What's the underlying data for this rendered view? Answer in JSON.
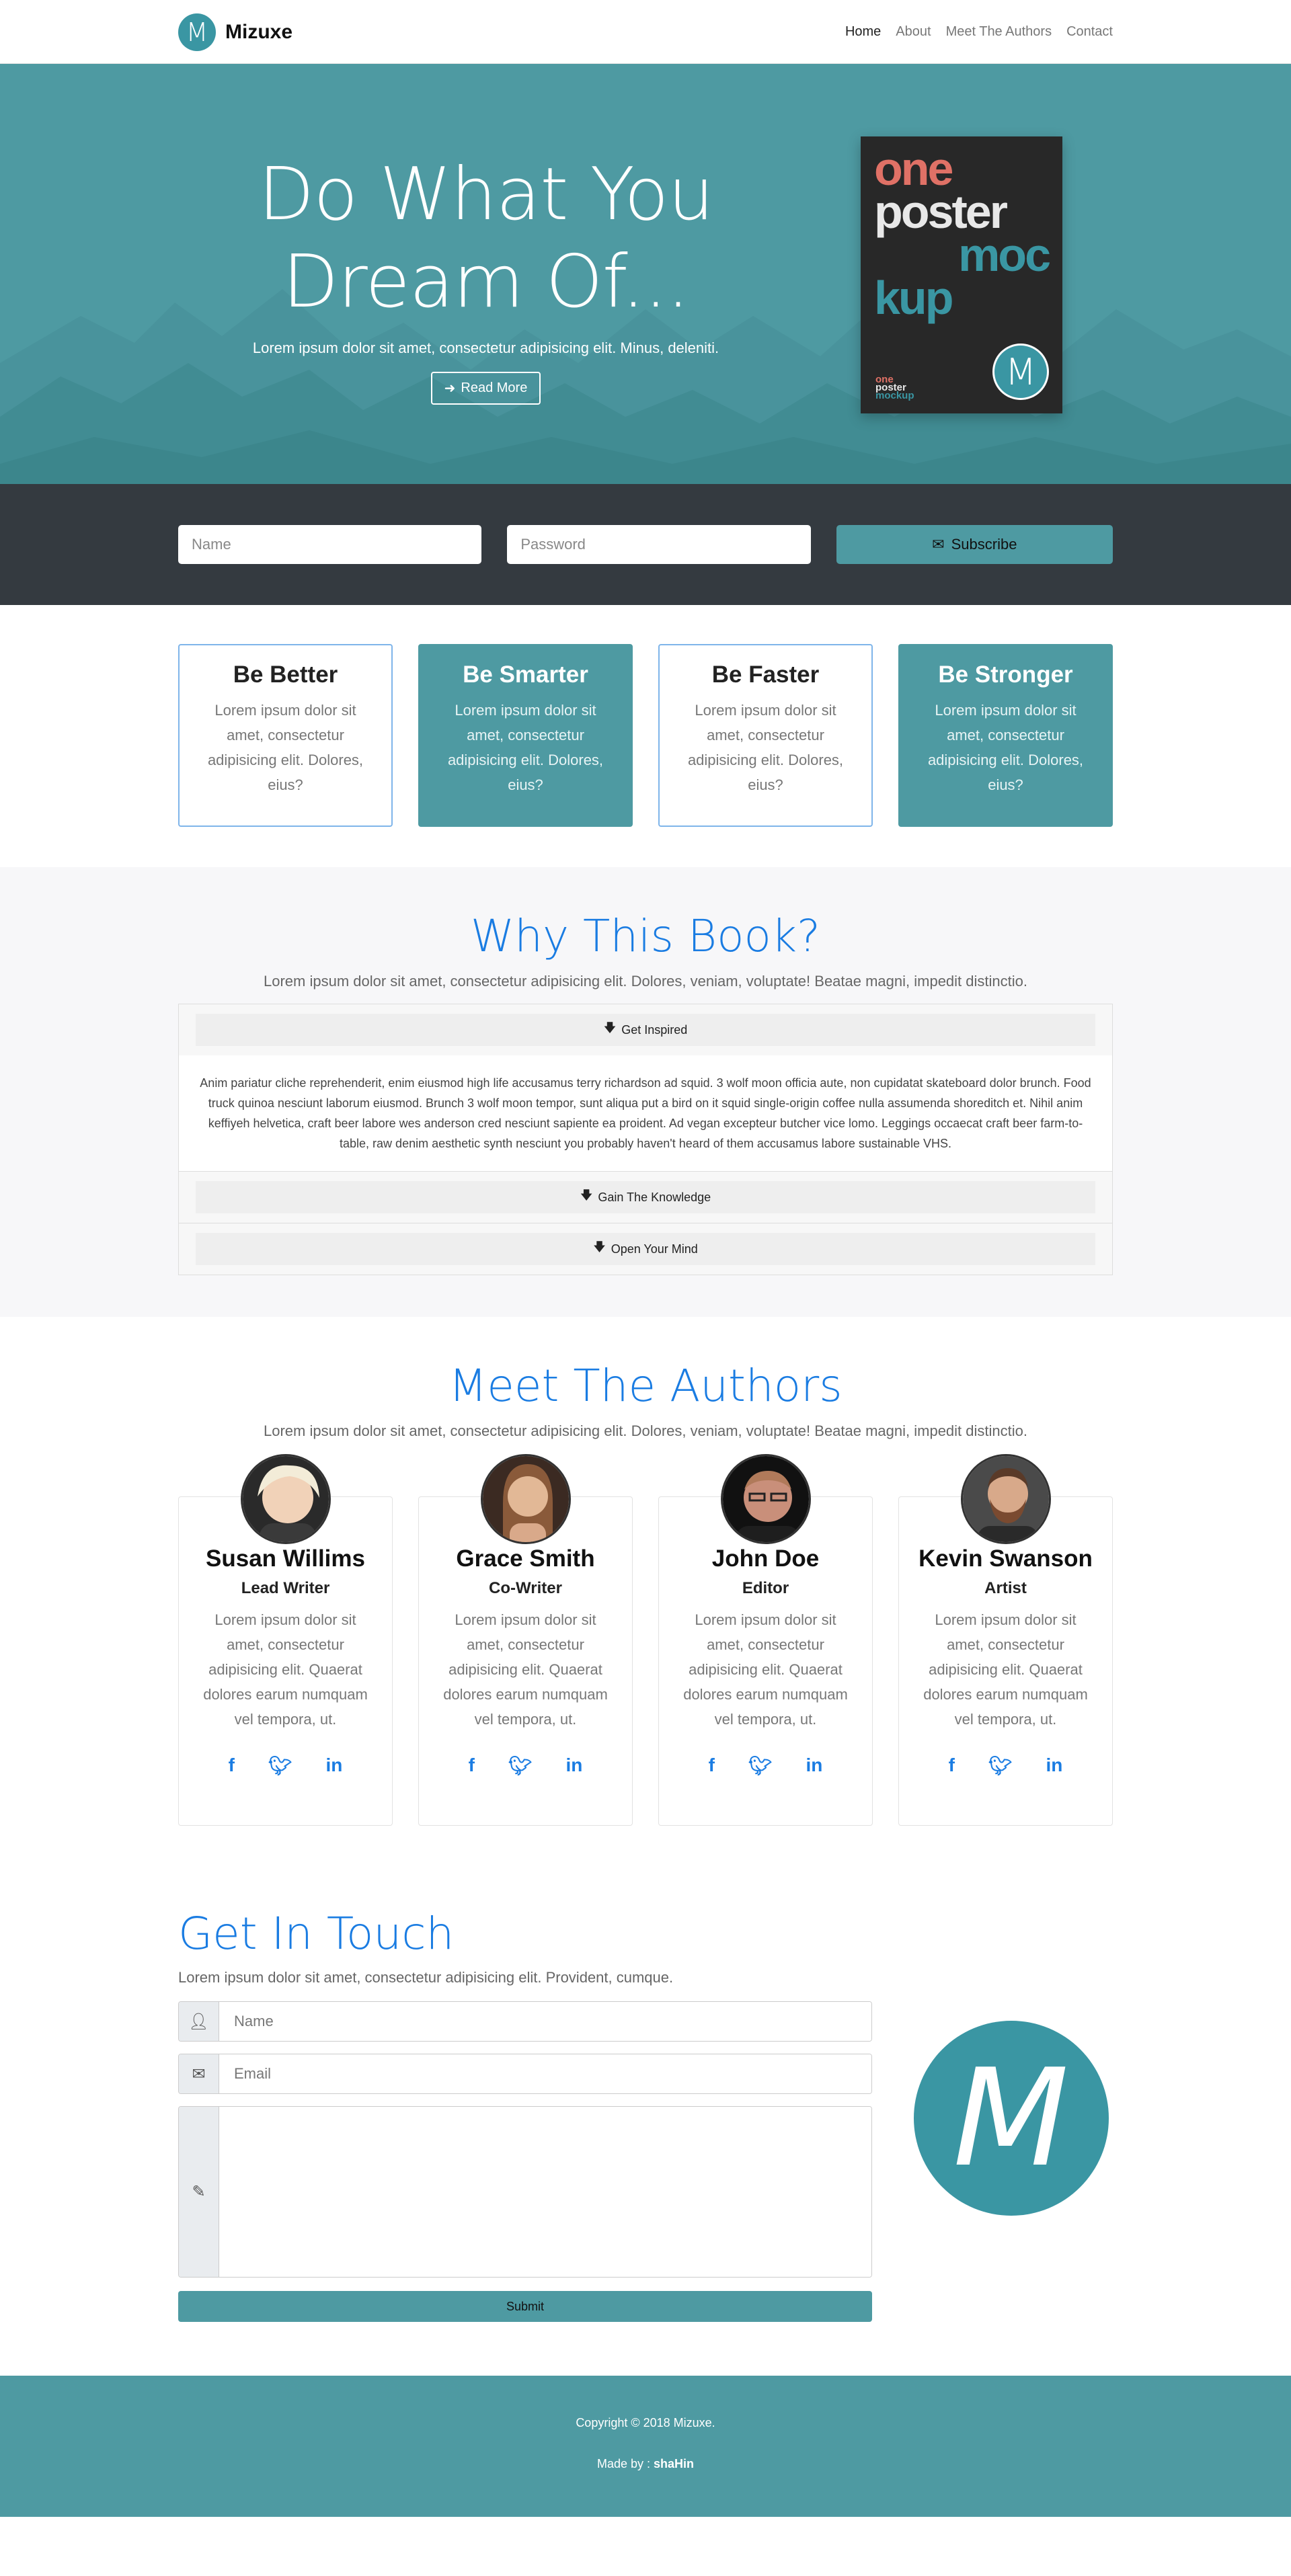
{
  "nav": {
    "brand_letter": "M",
    "brand_name": "Mizuxe",
    "links": [
      "Home",
      "About",
      "Meet The Authors",
      "Contact"
    ]
  },
  "hero": {
    "title_line1": "Do What You",
    "title_line2": "Dream Of...",
    "subtitle": "Lorem ipsum dolor sit amet, consectetur adipisicing elit. Minus, deleniti.",
    "button_label": "Read More",
    "poster": {
      "line1": "one",
      "line2": "poster",
      "line3": "moc",
      "line4": "kup",
      "small1": "one",
      "small2": "poster",
      "small3": "mockup",
      "badge": "M"
    }
  },
  "subscribe": {
    "name_placeholder": "Name",
    "password_placeholder": "Password",
    "button_label": "Subscribe"
  },
  "features": [
    {
      "title": "Be Better",
      "text": "Lorem ipsum dolor sit amet, consectetur adipisicing elit. Dolores, eius?"
    },
    {
      "title": "Be Smarter",
      "text": "Lorem ipsum dolor sit amet, consectetur adipisicing elit. Dolores, eius?"
    },
    {
      "title": "Be Faster",
      "text": "Lorem ipsum dolor sit amet, consectetur adipisicing elit. Dolores, eius?"
    },
    {
      "title": "Be Stronger",
      "text": "Lorem ipsum dolor sit amet, consectetur adipisicing elit. Dolores, eius?"
    }
  ],
  "why": {
    "title": "Why This Book?",
    "lead": "Lorem ipsum dolor sit amet, consectetur adipisicing elit. Dolores, veniam, voluptate! Beatae magni, impedit distinctio.",
    "items": [
      {
        "label": "Get Inspired",
        "body": "Anim pariatur cliche reprehenderit, enim eiusmod high life accusamus terry richardson ad squid. 3 wolf moon officia aute, non cupidatat skateboard dolor brunch. Food truck quinoa nesciunt laborum eiusmod. Brunch 3 wolf moon tempor, sunt aliqua put a bird on it squid single-origin coffee nulla assumenda shoreditch et. Nihil anim keffiyeh helvetica, craft beer labore wes anderson cred nesciunt sapiente ea proident. Ad vegan excepteur butcher vice lomo. Leggings occaecat craft beer farm-to-table, raw denim aesthetic synth nesciunt you probably haven't heard of them accusamus labore sustainable VHS."
      },
      {
        "label": "Gain The Knowledge"
      },
      {
        "label": "Open Your Mind"
      }
    ]
  },
  "authors": {
    "title": "Meet The Authors",
    "lead": "Lorem ipsum dolor sit amet, consectetur adipisicing elit. Dolores, veniam, voluptate! Beatae magni, impedit distinctio.",
    "people": [
      {
        "name": "Susan Willims",
        "role": "Lead Writer",
        "bio": "Lorem ipsum dolor sit amet, consectetur adipisicing elit. Quaerat dolores earum numquam vel tempora, ut."
      },
      {
        "name": "Grace Smith",
        "role": "Co-Writer",
        "bio": "Lorem ipsum dolor sit amet, consectetur adipisicing elit. Quaerat dolores earum numquam vel tempora, ut."
      },
      {
        "name": "John Doe",
        "role": "Editor",
        "bio": "Lorem ipsum dolor sit amet, consectetur adipisicing elit. Quaerat dolores earum numquam vel tempora, ut."
      },
      {
        "name": "Kevin Swanson",
        "role": "Artist",
        "bio": "Lorem ipsum dolor sit amet, consectetur adipisicing elit. Quaerat dolores earum numquam vel tempora, ut."
      }
    ],
    "social_icons": [
      "facebook-icon",
      "twitter-icon",
      "linkedin-icon"
    ]
  },
  "contact": {
    "title": "Get In Touch",
    "lead": "Lorem ipsum dolor sit amet, consectetur adipisicing elit. Provident, cumque.",
    "name_placeholder": "Name",
    "email_placeholder": "Email",
    "submit_label": "Submit",
    "logo_letter": "M"
  },
  "footer": {
    "copyright": "Copyright © 2018 Mizuxe.",
    "made_by_prefix": "Made by :",
    "made_by_name": "shaHin"
  },
  "colors": {
    "teal": "#4e9aa2",
    "dark": "#343a40",
    "blue": "#1a7ce2"
  }
}
